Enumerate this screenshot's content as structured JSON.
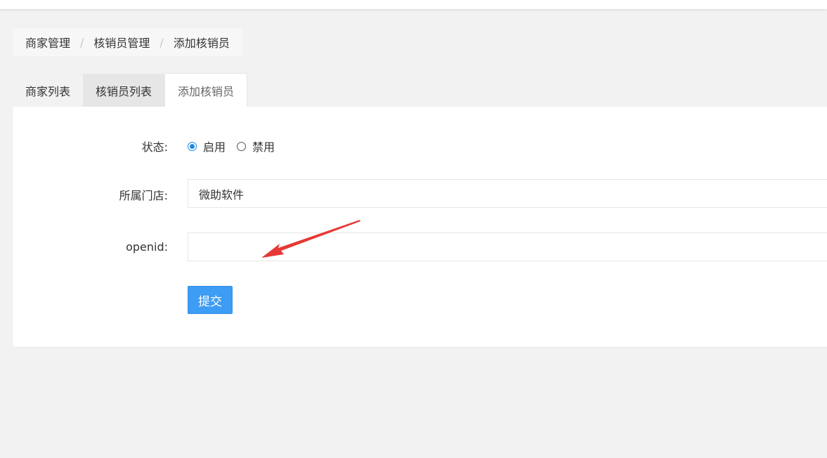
{
  "breadcrumb": {
    "items": [
      "商家管理",
      "核销员管理",
      "添加核销员"
    ],
    "separator": "/"
  },
  "tabs": [
    {
      "label": "商家列表",
      "active": false
    },
    {
      "label": "核销员列表",
      "active": false
    },
    {
      "label": "添加核销员",
      "active": true
    }
  ],
  "form": {
    "status": {
      "label": "状态:",
      "options": [
        {
          "label": "启用",
          "checked": true
        },
        {
          "label": "禁用",
          "checked": false
        }
      ]
    },
    "store": {
      "label": "所属门店:",
      "value": "微助软件"
    },
    "openid": {
      "label": "openid:",
      "value": ""
    },
    "submit_label": "提交"
  },
  "colors": {
    "primary": "#3d9cf3",
    "radio_checked": "#1e88e5",
    "annotation_arrow": "#e53935",
    "background": "#f2f2f2"
  },
  "annotation": {
    "icon": "red-arrow-icon"
  }
}
